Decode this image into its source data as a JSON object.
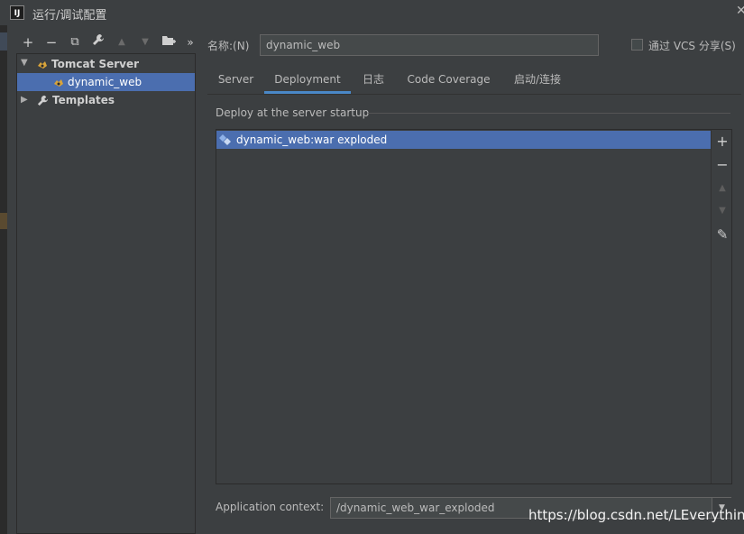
{
  "window": {
    "title": "运行/调试配置",
    "logo_text": "IJ",
    "close_glyph": "✕"
  },
  "toolbar": {
    "add": "+",
    "remove": "−",
    "copy": "⧉",
    "edit": "🔧",
    "up": "▲",
    "down": "▼",
    "folder": "▇",
    "more": "»"
  },
  "tree": {
    "tomcat_server": {
      "label": "Tomcat Server",
      "arrow": "▼"
    },
    "dynamic_web": {
      "label": "dynamic_web"
    },
    "templates": {
      "label": "Templates",
      "arrow": "▶"
    }
  },
  "name_field": {
    "label": "名称:(N)",
    "value": "dynamic_web"
  },
  "vcs": {
    "label": "通过 VCS 分享(S)",
    "checked": false
  },
  "tabs": [
    "Server",
    "Deployment",
    "日志",
    "Code Coverage",
    "启动/连接"
  ],
  "active_tab": "Deployment",
  "deploy": {
    "group_title": "Deploy at the server startup",
    "items": [
      "dynamic_web:war exploded"
    ],
    "side_buttons": {
      "add": "+",
      "remove": "−",
      "up": "▲",
      "down": "▼",
      "edit": "✎"
    }
  },
  "app_context": {
    "label": "Application context:",
    "value": "/dynamic_web_war_exploded",
    "drop_glyph": "▼"
  },
  "watermark": "https://blog.csdn.net/LEverything",
  "colors": {
    "bg": "#3c3f41",
    "selection": "#4b6eaf",
    "tab_underline": "#4a88c7"
  }
}
